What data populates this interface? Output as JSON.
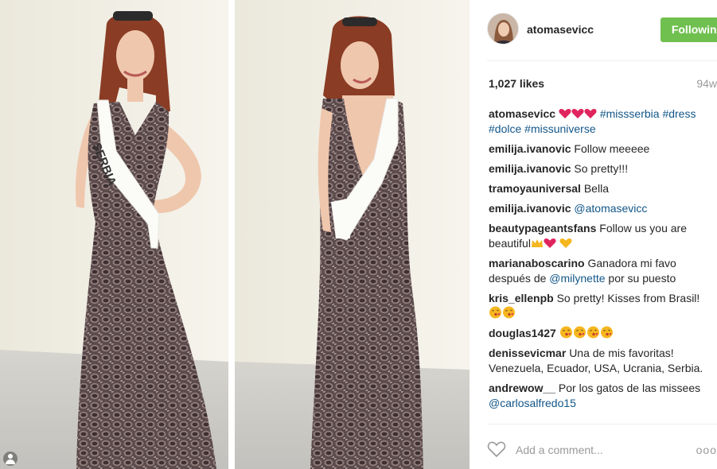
{
  "post": {
    "username": "atomasevicc",
    "follow_label": "Following",
    "likes": "1,027 likes",
    "age": "94w",
    "caption": {
      "user": "atomasevicc",
      "hashtags": [
        "#missserbia",
        "#dress",
        "#dolce",
        "#missuniverse"
      ]
    },
    "sash_text": "SERBIA"
  },
  "comments": [
    {
      "user": "emilija.ivanovic",
      "text": "Follow meeeee"
    },
    {
      "user": "emilija.ivanovic",
      "text": "So pretty!!!"
    },
    {
      "user": "tramoyauniversal",
      "text": "Bella"
    },
    {
      "user": "emilija.ivanovic",
      "text": "@atomasevicc"
    },
    {
      "user": "beautypageantsfans",
      "text": "Follow us you are beautiful"
    },
    {
      "user": "marianaboscarino",
      "text": "Ganadora mi favo después de",
      "mention": "@milynette",
      "text2": "por su puesto"
    },
    {
      "user": "kris_ellenpb",
      "text": "So pretty! Kisses from Brasil!"
    },
    {
      "user": "douglas1427",
      "text": ""
    },
    {
      "user": "denissevicmar",
      "text": "Una de mis favoritas! Venezuela, Ecuador, USA, Ucrania, Serbia."
    },
    {
      "user": "andrewow__",
      "text": "Por los gatos de las missees",
      "mention": "@carlosalfredo15"
    }
  ],
  "add_comment_placeholder": "Add a comment...",
  "more_label": "ooo",
  "icons": {
    "heart": "heart-outline-icon",
    "emoji_heart": "red-heart-emoji",
    "emoji_kiss": "kiss-face-emoji",
    "emoji_crown": "crown-emoji",
    "emoji_yellow_heart": "yellow-heart-emoji"
  },
  "colors": {
    "following": "#70c050",
    "link": "#125688",
    "muted": "#999999",
    "emoji_red": "#e0245e",
    "emoji_yellow": "#f5b71f"
  }
}
